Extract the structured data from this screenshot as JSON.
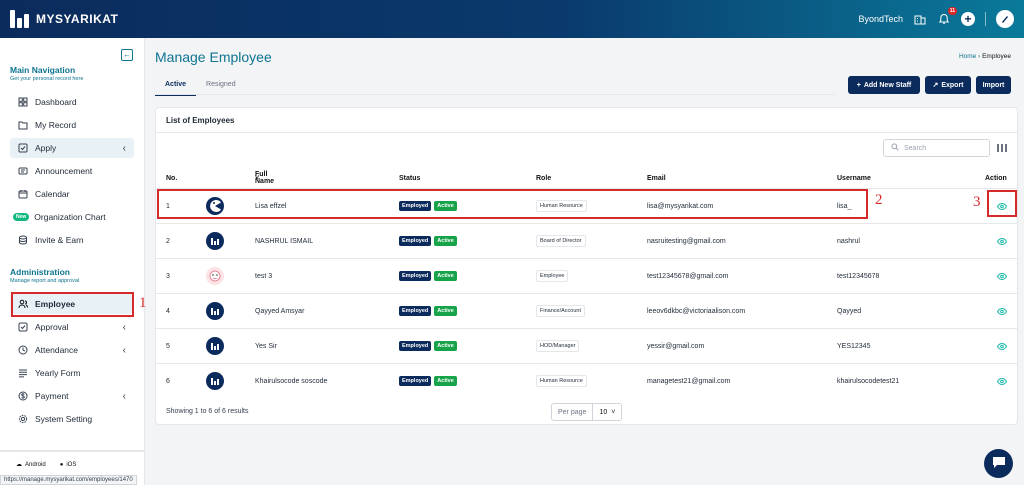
{
  "app": {
    "name": "MYSYARIKAT"
  },
  "topbar": {
    "company": "ByondTech",
    "notification_count": "11"
  },
  "sidebar": {
    "main_title": "Main Navigation",
    "main_sub": "Get your personal record here",
    "main_items": [
      {
        "label": "Dashboard",
        "icon": "grid-icon"
      },
      {
        "label": "My Record",
        "icon": "folder-icon"
      },
      {
        "label": "Apply",
        "icon": "checkbox-icon"
      },
      {
        "label": "Announcement",
        "icon": "megaphone-icon"
      },
      {
        "label": "Calendar",
        "icon": "calendar-icon"
      },
      {
        "label": "Organization Chart",
        "tag": "New"
      },
      {
        "label": "Invite & Earn",
        "icon": "database-icon"
      }
    ],
    "admin_title": "Administration",
    "admin_sub": "Manage report and approval",
    "admin_items": [
      {
        "label": "Employee",
        "icon": "users-icon"
      },
      {
        "label": "Approval",
        "icon": "check-square-icon"
      },
      {
        "label": "Attendance",
        "icon": "clock-icon"
      },
      {
        "label": "Yearly Form",
        "icon": "list-icon"
      },
      {
        "label": "Payment",
        "icon": "dollar-icon"
      },
      {
        "label": "System Setting",
        "icon": "gear-icon"
      }
    ],
    "platforms": [
      "Android",
      "iOS"
    ]
  },
  "statusbar": {
    "url": "https://manage.mysyarikat.com/employees/1470"
  },
  "page": {
    "title": "Manage Employee",
    "breadcrumb_home": "Home",
    "breadcrumb_current": "Employee",
    "tabs": [
      "Active",
      "Resigned"
    ],
    "buttons": {
      "add": "Add New Staff",
      "export": "Export",
      "import": "Import"
    }
  },
  "card": {
    "title": "List of Employees",
    "search_placeholder": "Search",
    "headers": [
      "No.",
      "Full Name",
      "Status",
      "Role",
      "Email",
      "Username",
      "Action"
    ],
    "rows": [
      {
        "no": "1",
        "name": "Lisa effzel",
        "status": "Employed",
        "state": "Active",
        "role": "Human Resource",
        "email": "lisa@mysyarikat.com",
        "username": "lisa_"
      },
      {
        "no": "2",
        "name": "NASHRUL ISMAIL",
        "status": "Employed",
        "state": "Active",
        "role": "Board of Director",
        "email": "nasruitesting@gmail.com",
        "username": "nashrul"
      },
      {
        "no": "3",
        "name": "test 3",
        "status": "Employed",
        "state": "Active",
        "role": "Employee",
        "email": "test12345678@gmail.com",
        "username": "test12345678"
      },
      {
        "no": "4",
        "name": "Qayyed Amsyar",
        "status": "Employed",
        "state": "Active",
        "role": "Finance/Account",
        "email": "leeov6dkbc@victoriaalison.com",
        "username": "Qayyed"
      },
      {
        "no": "5",
        "name": "Yes Sir",
        "status": "Employed",
        "state": "Active",
        "role": "HOD/Manager",
        "email": "yessir@gmail.com",
        "username": "YES12345"
      },
      {
        "no": "6",
        "name": "Khairulsocode soscode",
        "status": "Employed",
        "state": "Active",
        "role": "Human Resource",
        "email": "managetest21@gmail.com",
        "username": "khairulsocodetest21"
      }
    ],
    "footer": "Showing 1 to 6 of 6 results",
    "per_page_label": "Per page",
    "per_page_value": "10"
  },
  "annotations": [
    "1",
    "2",
    "3"
  ],
  "colors": {
    "accent": "#0e7490",
    "navy": "#0b2b5c",
    "highlight": "#d42a2a",
    "active_green": "#16a34a"
  }
}
